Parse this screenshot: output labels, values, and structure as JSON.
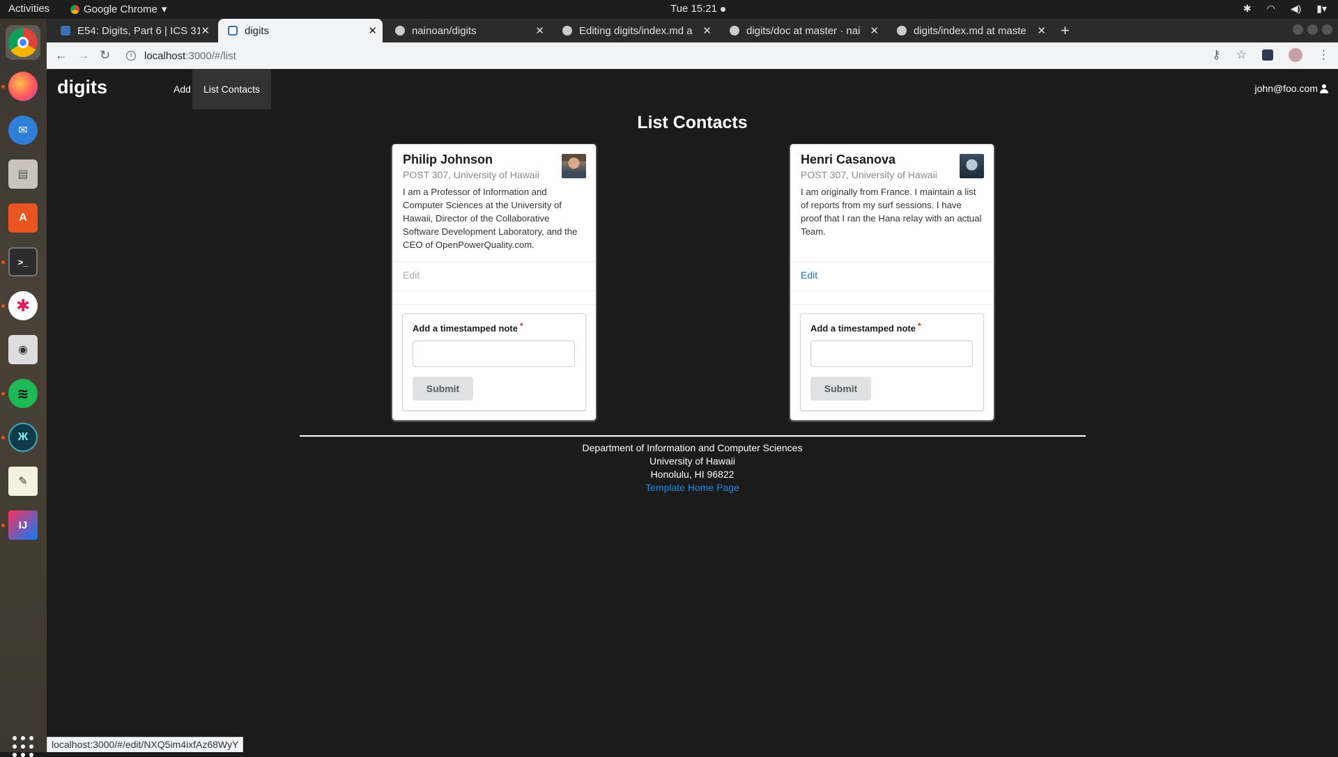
{
  "system": {
    "activities": "Activities",
    "app_name": "Google Chrome",
    "clock": "Tue 15:21"
  },
  "browser": {
    "tabs": [
      {
        "title": "E54: Digits, Part 6 | ICS 31",
        "active": false
      },
      {
        "title": "digits",
        "active": true
      },
      {
        "title": "nainoan/digits",
        "active": false
      },
      {
        "title": "Editing digits/index.md a",
        "active": false
      },
      {
        "title": "digits/doc at master · nai",
        "active": false
      },
      {
        "title": "digits/index.md at maste",
        "active": false
      }
    ],
    "url_host": "localhost",
    "url_path": ":3000/#/list",
    "status_url": "localhost:3000/#/edit/NXQ5im4ixfAz68WyY"
  },
  "app": {
    "brand": "digits",
    "nav": [
      {
        "label": "Add Contact",
        "active": false
      },
      {
        "label": "List Contacts",
        "active": true
      }
    ],
    "user": "john@foo.com"
  },
  "main": {
    "title": "List Contacts",
    "contacts": [
      {
        "name": "Philip Johnson",
        "address": "POST 307, University of Hawaii",
        "description": "I am a Professor of Information and Computer Sciences at the University of Hawaii, Director of the Collaborative Software Development Laboratory, and the CEO of OpenPowerQuality.com.",
        "edit_label": "Edit",
        "note_label": "Add a timestamped note",
        "note_value": "",
        "submit_label": "Submit"
      },
      {
        "name": "Henri Casanova",
        "address": "POST 307, University of Hawaii",
        "description": "I am originally from France. I maintain a list of reports from my surf sessions. I have proof that I ran the Hana relay with an actual Team.",
        "edit_label": "Edit",
        "note_label": "Add a timestamped note",
        "note_value": "",
        "submit_label": "Submit"
      }
    ]
  },
  "footer": {
    "line1": "Department of Information and Computer Sciences",
    "line2": "University of Hawaii",
    "line3": "Honolulu, HI 96822",
    "link": "Template Home Page"
  }
}
